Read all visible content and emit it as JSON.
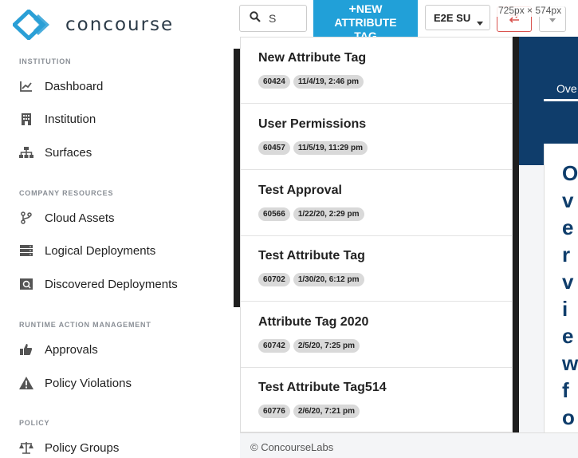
{
  "brand": {
    "name": "concourse",
    "primary": "#2a9fd6",
    "accent": "#21a0d8",
    "navy": "#0f3d6b"
  },
  "sidebar": {
    "sections": [
      {
        "title": "INSTITUTION"
      },
      {
        "title": "COMPANY RESOURCES"
      },
      {
        "title": "RUNTIME ACTION MANAGEMENT"
      },
      {
        "title": "POLICY"
      }
    ],
    "items": [
      {
        "label": "Dashboard",
        "icon": "chart-icon"
      },
      {
        "label": "Institution",
        "icon": "building-icon"
      },
      {
        "label": "Surfaces",
        "icon": "sitemap-icon"
      },
      {
        "label": "Cloud Assets",
        "icon": "branch-icon"
      },
      {
        "label": "Logical Deployments",
        "icon": "server-icon"
      },
      {
        "label": "Discovered Deployments",
        "icon": "scan-icon"
      },
      {
        "label": "Approvals",
        "icon": "thumbs-up-icon"
      },
      {
        "label": "Policy Violations",
        "icon": "warning-icon"
      },
      {
        "label": "Policy Groups",
        "icon": "scale-icon"
      }
    ]
  },
  "header": {
    "search": {
      "value": "S",
      "placeholder": ""
    },
    "new_tag": {
      "plus": "+",
      "label_line1": "NEW",
      "label_line2": "ATTRIBUTE",
      "label_line3": "TAG"
    },
    "environment": "E2E SU",
    "dimension_overlay": "725px × 574px"
  },
  "dropdown": {
    "items": [
      {
        "title": "New Attribute Tag",
        "id": "60424",
        "date": "11/4/19, 2:46 pm"
      },
      {
        "title": "User Permissions",
        "id": "60457",
        "date": "11/5/19, 11:29 pm"
      },
      {
        "title": "Test Approval",
        "id": "60566",
        "date": "1/22/20, 2:29 pm"
      },
      {
        "title": "Test Attribute Tag",
        "id": "60702",
        "date": "1/30/20, 6:12 pm"
      },
      {
        "title": "Attribute Tag 2020",
        "id": "60742",
        "date": "2/5/20, 7:25 pm"
      },
      {
        "title": "Test Attribute Tag514",
        "id": "60776",
        "date": "2/6/20, 7:21 pm"
      }
    ]
  },
  "main": {
    "tab_label": "Ove",
    "heading_fragment": "Overview for"
  },
  "footer": {
    "copyright": "© ConcourseLabs"
  }
}
